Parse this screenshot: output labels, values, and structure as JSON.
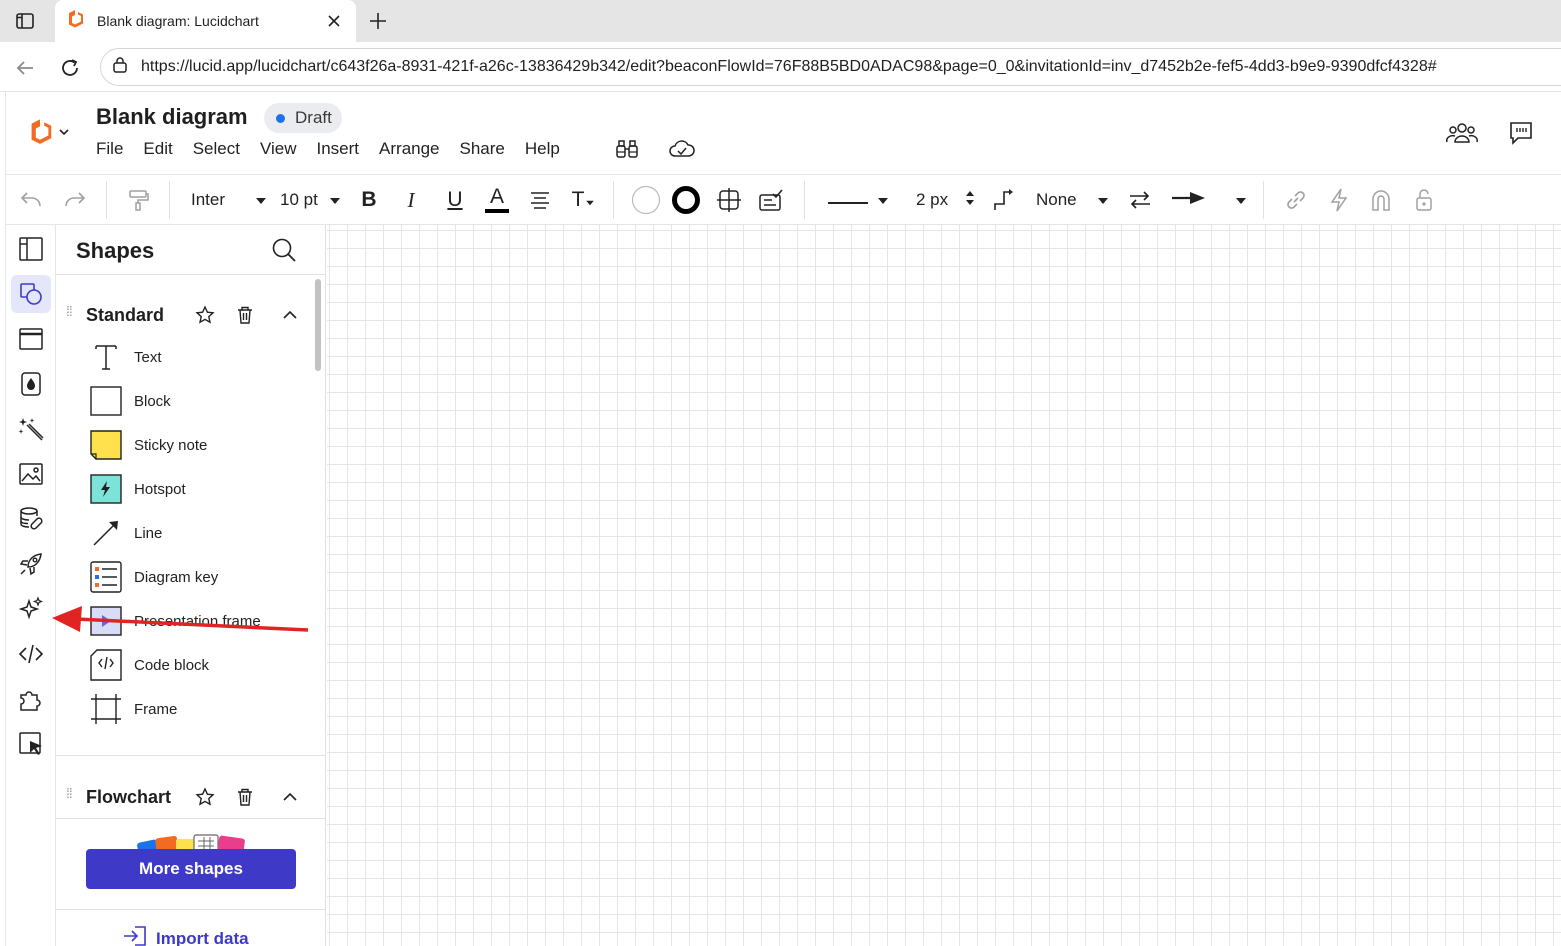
{
  "browser": {
    "tab_title": "Blank diagram: Lucidchart",
    "url": "https://lucid.app/lucidchart/c643f26a-8931-421f-a26c-13836429b342/edit?beaconFlowId=76F88B5BD0ADAC98&page=0_0&invitationId=inv_d7452b2e-fef5-4dd3-b9e9-9390dfcf4328#"
  },
  "app": {
    "doc_title": "Blank diagram",
    "status_badge": "Draft",
    "menu": [
      "File",
      "Edit",
      "Select",
      "View",
      "Insert",
      "Arrange",
      "Share",
      "Help"
    ]
  },
  "toolbar": {
    "font_family": "Inter",
    "font_size": "10 pt",
    "bold": "B",
    "italic": "I",
    "underline": "U",
    "text_color": "A",
    "text_tool": "T",
    "line_width": "2 px",
    "line_end": "None"
  },
  "panel": {
    "title": "Shapes",
    "sections": [
      {
        "title": "Standard",
        "items": [
          {
            "label": "Text",
            "icon": "text-shape-icon"
          },
          {
            "label": "Block",
            "icon": "block-shape-icon"
          },
          {
            "label": "Sticky note",
            "icon": "sticky-note-icon"
          },
          {
            "label": "Hotspot",
            "icon": "hotspot-icon"
          },
          {
            "label": "Line",
            "icon": "line-arrow-icon"
          },
          {
            "label": "Diagram key",
            "icon": "diagram-key-icon"
          },
          {
            "label": "Presentation frame",
            "icon": "presentation-frame-icon"
          },
          {
            "label": "Code block",
            "icon": "code-block-icon"
          },
          {
            "label": "Frame",
            "icon": "frame-icon"
          }
        ]
      },
      {
        "title": "Flowchart",
        "items": []
      }
    ],
    "more_shapes": "More shapes",
    "import_data": "Import data"
  },
  "colors": {
    "accent": "#3f39c8",
    "rail_active": "#e4e6fb",
    "sticky": "#ffe14d",
    "hotspot": "#7de3d9",
    "annotation_arrow": "#e02424",
    "draft_dot": "#1a73e8"
  }
}
